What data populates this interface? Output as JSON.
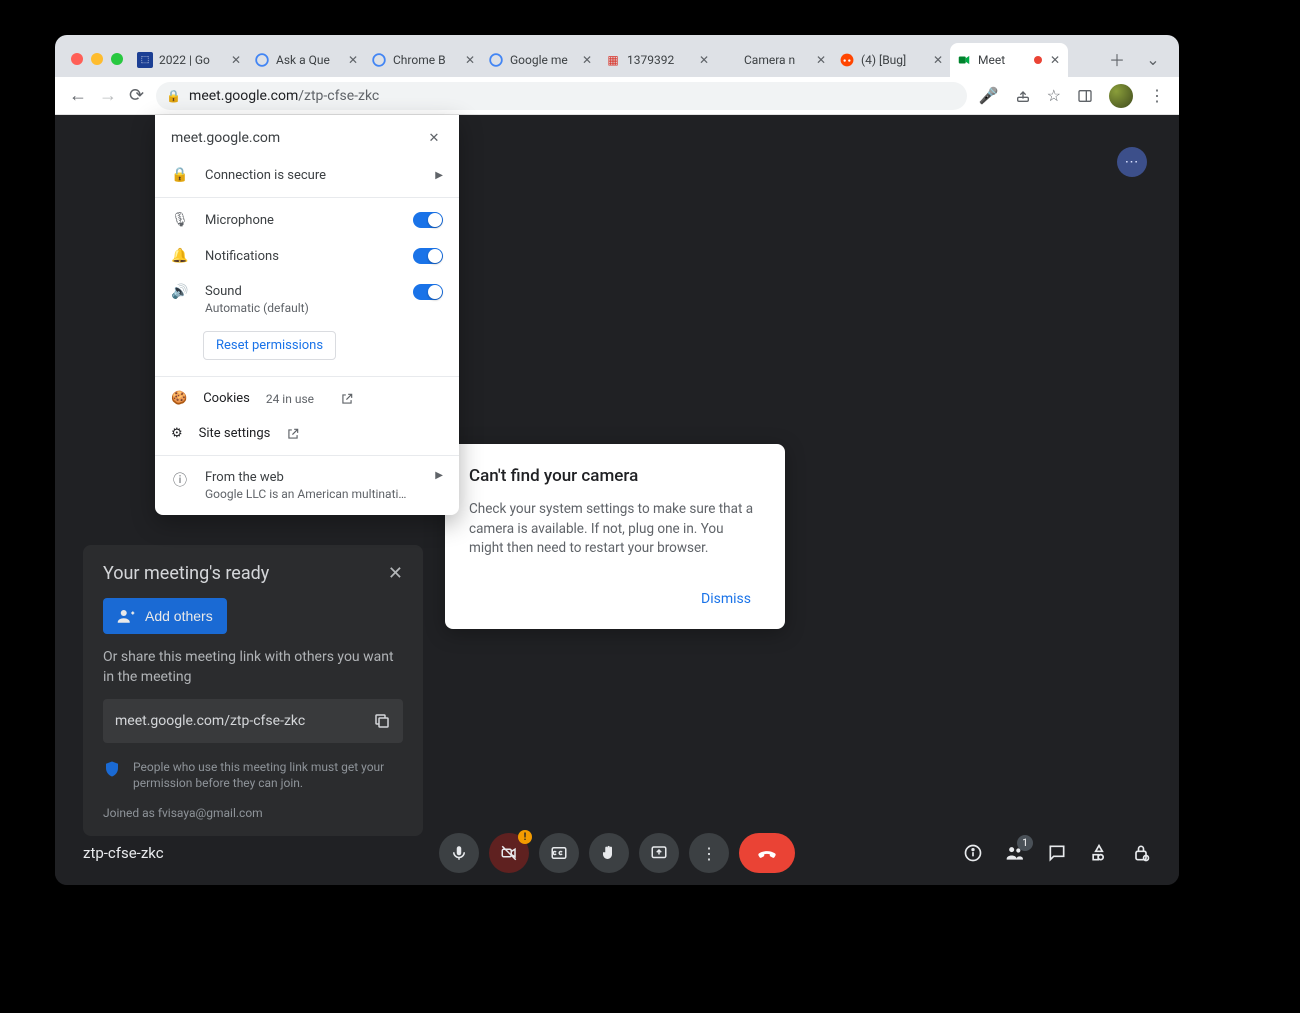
{
  "window": {
    "tabs": [
      {
        "title": "2022 | Go",
        "favicon": "doc"
      },
      {
        "title": "Ask a Que",
        "favicon": "g"
      },
      {
        "title": "Chrome B",
        "favicon": "g"
      },
      {
        "title": "Google me",
        "favicon": "g"
      },
      {
        "title": "1379392",
        "favicon": "bug"
      },
      {
        "title": "Camera n",
        "favicon": "apple"
      },
      {
        "title": "(4) [Bug]",
        "favicon": "reddit"
      },
      {
        "title": "Meet",
        "favicon": "meet",
        "recording": true,
        "active": true
      }
    ],
    "url_host": "meet.google.com",
    "url_path": "/ztp-cfse-zkc"
  },
  "site_info": {
    "site": "meet.google.com",
    "conn": "Connection is secure",
    "perms": {
      "microphone": "Microphone",
      "notifications": "Notifications",
      "sound": "Sound",
      "sound_sub": "Automatic (default)"
    },
    "reset": "Reset permissions",
    "cookies": "Cookies",
    "cookies_use": "24 in use",
    "site_settings": "Site settings",
    "from_web": "From the web",
    "from_web_sub": "Google LLC is an American multinati…"
  },
  "camera_err": {
    "title": "Can't find your camera",
    "body": "Check your system settings to make sure that a camera is available. If not, plug one in. You might then need to restart your browser.",
    "dismiss": "Dismiss"
  },
  "ready_panel": {
    "title": "Your meeting's ready",
    "add_others": "Add others",
    "share_text": "Or share this meeting link with others you want in the meeting",
    "link": "meet.google.com/ztp-cfse-zkc",
    "perm_note": "People who use this meeting link must get your permission before they can join.",
    "joined_as": "Joined as fvisaya@gmail.com"
  },
  "bottom": {
    "code": "ztp-cfse-zkc",
    "people_badge": "1"
  }
}
